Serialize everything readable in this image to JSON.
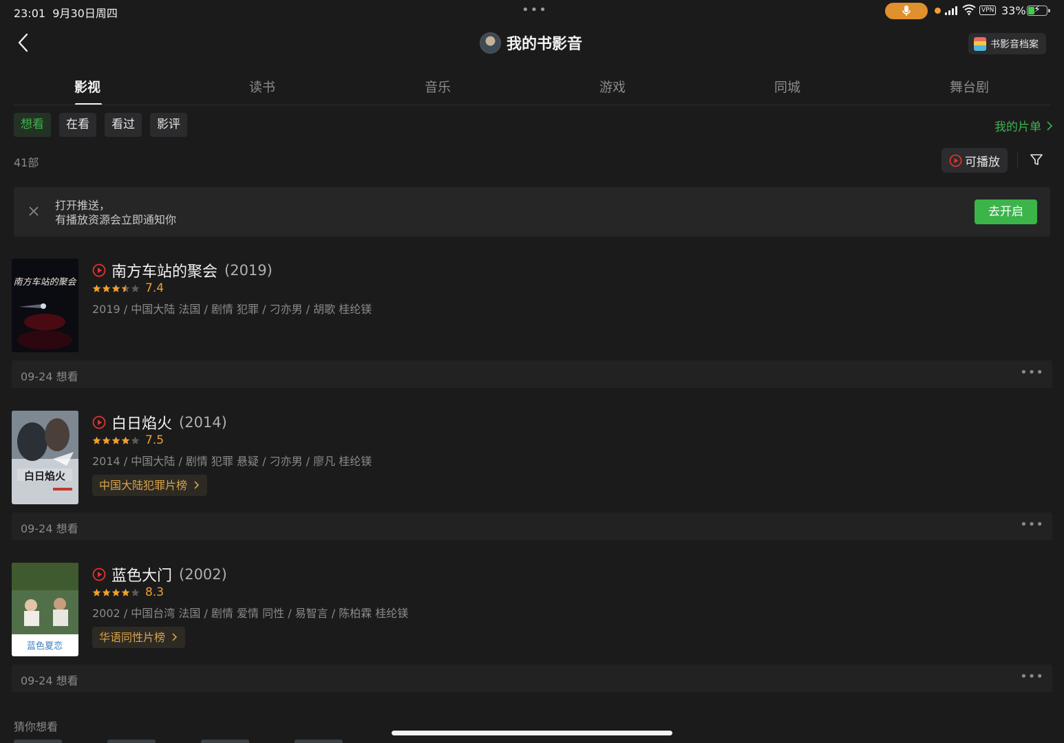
{
  "status": {
    "time": "23:01",
    "date": "9月30日周四",
    "vpn": "VPN",
    "battery": "33%",
    "battery_level": 0.33
  },
  "header": {
    "title": "我的书影音",
    "archive_label": "书影音档案"
  },
  "tabs": [
    "影视",
    "读书",
    "音乐",
    "游戏",
    "同城",
    "舞台剧"
  ],
  "active_tab": 0,
  "sub_tabs": [
    "想看",
    "在看",
    "看过",
    "影评"
  ],
  "active_sub_tab": 0,
  "my_list_label": "我的片单",
  "count_label": "41部",
  "playable_label": "可播放",
  "push": {
    "line1": "打开推送，",
    "line2": "有播放资源会立即通知你",
    "button": "去开启"
  },
  "movies": [
    {
      "title": "南方车站的聚会",
      "year": "(2019)",
      "score": "7.4",
      "stars": 3.5,
      "meta": "2019 / 中国大陆 法国 / 剧情 犯罪 / 刁亦男 / 胡歌 桂纶镁",
      "date": "09-24 想看",
      "poster_text": "南方车站的聚会",
      "colors": {
        "accent": "#e0352f"
      }
    },
    {
      "title": "白日焰火",
      "year": "(2014)",
      "score": "7.5",
      "stars": 4,
      "meta": "2014 / 中国大陆 / 剧情 犯罪 悬疑 / 刁亦男 / 廖凡 桂纶镁",
      "rank": "中国大陆犯罪片榜",
      "date": "09-24 想看",
      "poster_text": "白日焰火"
    },
    {
      "title": "蓝色大门",
      "year": "(2002)",
      "score": "8.3",
      "stars": 4,
      "meta": "2002 / 中国台湾 法国 / 剧情 爱情 同性 / 易智言 / 陈柏霖 桂纶镁",
      "rank": "华语同性片榜",
      "date": "09-24 想看",
      "poster_text": "蓝色夏恋"
    }
  ],
  "guess_title": "猜你想看",
  "colors": {
    "accent_green": "#3bb44a",
    "star_orange": "#f0a030",
    "play_red": "#e0352f",
    "background": "#1b1b1c"
  }
}
